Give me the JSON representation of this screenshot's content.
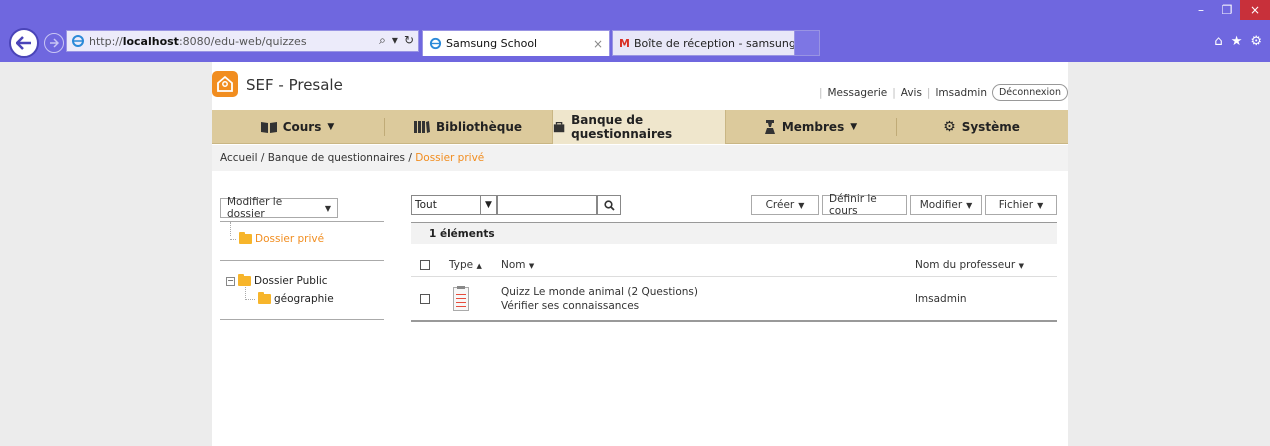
{
  "browser": {
    "address_scheme": "http://",
    "address_host": "localhost",
    "address_path": ":8080/edu-web/quizzes",
    "tabs": [
      {
        "label": "Samsung School",
        "close": "×"
      },
      {
        "label": "Boîte de réception - samsungs..."
      }
    ],
    "window_controls": {
      "minimize": "–",
      "restore": "❐",
      "close": "×"
    },
    "icons": {
      "home": "home-icon",
      "favorites": "star-icon",
      "tools": "gear-icon"
    }
  },
  "header": {
    "site_title": "SEF - Presale",
    "links": {
      "messaging": "Messagerie",
      "notices": "Avis",
      "user": "lmsadmin",
      "logout": "Déconnexion"
    }
  },
  "nav": {
    "items": [
      {
        "label": "Cours",
        "icon": "book-icon",
        "dropdown": true
      },
      {
        "label": "Bibliothèque",
        "icon": "library-icon",
        "dropdown": false
      },
      {
        "label": "Banque de questionnaires",
        "icon": "question-bank-icon",
        "dropdown": false,
        "active": true
      },
      {
        "label": "Membres",
        "icon": "person-icon",
        "dropdown": true
      },
      {
        "label": "Système",
        "icon": "gear-icon",
        "dropdown": false
      }
    ]
  },
  "breadcrumb": {
    "items": [
      "Accueil",
      "Banque de questionnaires"
    ],
    "separator": " / ",
    "current": "Dossier privé"
  },
  "left_panel": {
    "modify_folder": "Modifier le dossier",
    "private_folder": "Dossier privé",
    "public_folder": "Dossier Public",
    "public_children": [
      "géographie"
    ]
  },
  "toolbar": {
    "filter_value": "Tout",
    "search_value": "",
    "create": "Créer",
    "set_course": "Définir le cours",
    "modify": "Modifier",
    "file": "Fichier"
  },
  "table": {
    "count_label": "1 éléments",
    "columns": {
      "type": "Type",
      "name": "Nom",
      "teacher": "Nom du professeur"
    },
    "sort_up": "▲",
    "sort_down": "▼",
    "rows": [
      {
        "title": "Quizz Le monde animal (2 Questions)",
        "subtitle": "Vérifier ses connaissances",
        "teacher": "lmsadmin"
      }
    ]
  },
  "colors": {
    "accent": "#f18d1f",
    "nav_bg": "#dcca9c",
    "chrome": "#6f67df"
  }
}
